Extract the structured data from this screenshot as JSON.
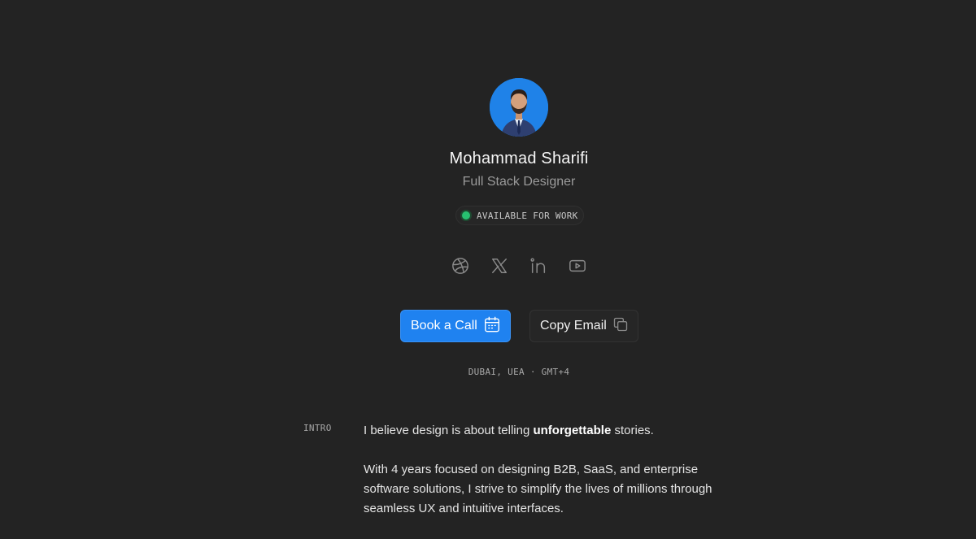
{
  "profile": {
    "name": "Mohammad Sharifi",
    "role": "Full Stack Designer",
    "availability": "AVAILABLE FOR WORK",
    "location": "DUBAI, UEA · GMT+4"
  },
  "socials": [
    {
      "icon": "dribbble-icon"
    },
    {
      "icon": "x-icon"
    },
    {
      "icon": "linkedin-icon"
    },
    {
      "icon": "youtube-icon"
    }
  ],
  "actions": {
    "book_label": "Book a Call",
    "copy_label": "Copy Email"
  },
  "intro": {
    "label": "INTRO",
    "line1_before": "I believe design is about telling ",
    "line1_emphasis": "unforgettable",
    "line1_after": " stories.",
    "paragraph2": "With 4 years focused on designing B2B, SaaS, and enterprise software solutions, I strive to simplify the lives of millions through seamless UX and intuitive interfaces."
  },
  "colors": {
    "background": "#232323",
    "accent": "#1f82f0",
    "status": "#27c070"
  }
}
